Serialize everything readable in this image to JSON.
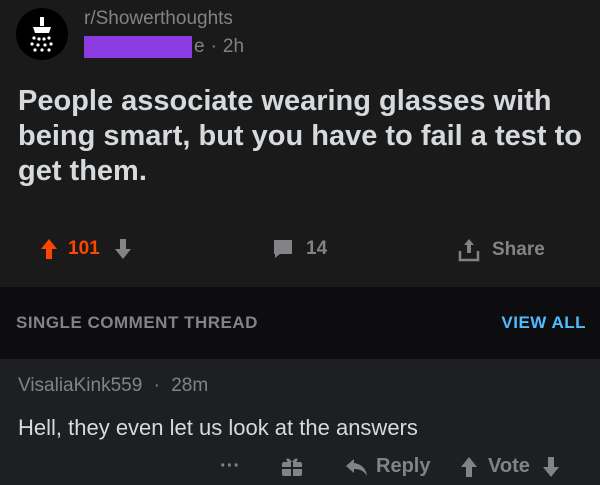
{
  "post": {
    "subreddit": "r/Showerthoughts",
    "author_tail": "e",
    "separator": "·",
    "age": "2h",
    "title": "People associate wearing glasses with being smart, but you have to fail a test to get them.",
    "votes": "101",
    "comments": "14",
    "share_label": "Share"
  },
  "thread": {
    "label": "SINGLE COMMENT THREAD",
    "view_all": "VIEW ALL"
  },
  "comment": {
    "author": "VisaliaKink559",
    "separator": "·",
    "age": "28m",
    "body": "Hell, they even let us look at the answers",
    "more": "···",
    "reply_label": "Reply",
    "vote_label": "Vote"
  },
  "colors": {
    "upvote_active": "#ff4500",
    "link_blue": "#4fbcff",
    "redaction": "#8a3ce0"
  }
}
